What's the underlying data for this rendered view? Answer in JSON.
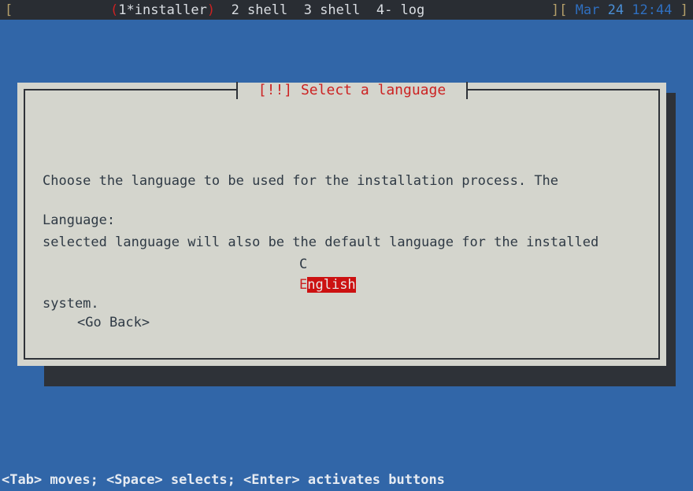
{
  "statusbar": {
    "left_bracket": "[",
    "active_window": "(1*installer)",
    "active_open_paren": "(",
    "active_name": "1*installer",
    "active_close_paren": ")",
    "windows": [
      {
        "label": "2 shell"
      },
      {
        "label": "3 shell"
      },
      {
        "label": "4- log"
      }
    ],
    "right_close_bracket": "]",
    "right_open_bracket": "[",
    "month": "Mar",
    "day": "24",
    "time": "12:44",
    "right_bracket_end": "]",
    "colors": {
      "background": "#292d33",
      "bracket": "#b5a06a",
      "paren": "#cc2222",
      "window": "#d9dde2",
      "date": "#2f6fbf",
      "day": "#4a8fd6"
    }
  },
  "dialog": {
    "title": "[!!] Select a language",
    "body_line1": "Choose the language to be used for the installation process. The",
    "body_line2": "selected language will also be the default language for the installed",
    "body_line3": "system.",
    "language_label": "Language:",
    "languages": [
      {
        "hotkey": "",
        "rest": "C",
        "full": "C",
        "selected": false
      },
      {
        "hotkey": "E",
        "rest": "nglish",
        "full": "English",
        "selected": true
      }
    ],
    "go_back_label": "<Go Back>",
    "colors": {
      "panel": "#d4d5cd",
      "border": "#2e3238",
      "title": "#cc2222",
      "text": "#2f3a45",
      "highlight": "#cc1111",
      "highlight_text": "#e8e8e8",
      "shadow": "#2e3238"
    }
  },
  "screen": {
    "background": "#3166a8"
  },
  "bottom_hint": {
    "text": "<Tab> moves; <Space> selects; <Enter> activates buttons"
  }
}
